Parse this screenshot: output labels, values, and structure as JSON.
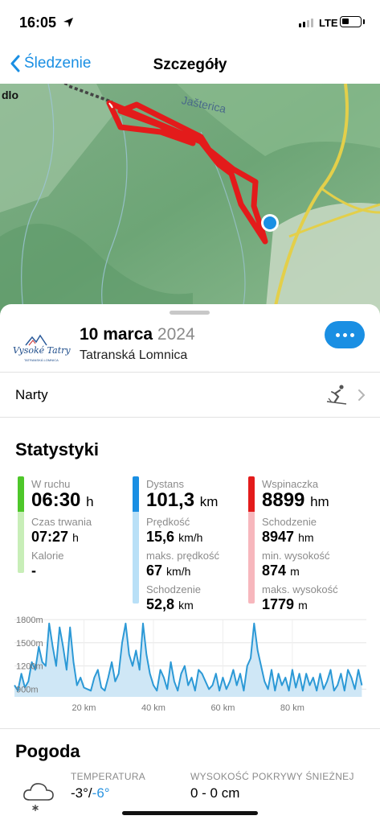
{
  "status": {
    "time": "16:05",
    "network": "LTE"
  },
  "nav": {
    "back_label": "Śledzenie",
    "title": "Szczegóły"
  },
  "map": {
    "labels": [
      "dlo",
      "Jašterica"
    ]
  },
  "activity": {
    "date_day": "10 marca",
    "date_year": "2024",
    "place": "Tatranská Lomnica",
    "logo_text": "Vysoké Tatry",
    "logo_subtext": "TATRANSKÁ LOMNICA"
  },
  "sport": {
    "label": "Narty",
    "icon": "skier-icon"
  },
  "stats": {
    "title": "Statystyki",
    "movement": {
      "label": "W ruchu",
      "value": "06:30",
      "unit": "h",
      "duration_label": "Czas trwania",
      "duration_value": "07:27",
      "duration_unit": "h",
      "calories_label": "Kalorie",
      "calories_value": "-"
    },
    "distance": {
      "label": "Dystans",
      "value": "101,3",
      "unit": "km",
      "speed_label": "Prędkość",
      "speed_value": "15,6",
      "speed_unit": "km/h",
      "max_speed_label": "maks. prędkość",
      "max_speed_value": "67",
      "max_speed_unit": "km/h",
      "descent_label": "Schodzenie",
      "descent_value": "52,8",
      "descent_unit": "km"
    },
    "climb": {
      "label": "Wspinaczka",
      "value": "8899",
      "unit": "hm",
      "descent_label": "Schodzenie",
      "descent_value": "8947",
      "descent_unit": "hm",
      "min_alt_label": "min. wysokość",
      "min_alt_value": "874",
      "min_alt_unit": "m",
      "max_alt_label": "maks. wysokość",
      "max_alt_value": "1779",
      "max_alt_unit": "m"
    },
    "colors": {
      "movement": "#4ec72a",
      "distance": "#1a8fe3",
      "climb": "#e31b1b"
    }
  },
  "chart_data": {
    "type": "area",
    "ylabel_ticks": [
      "1800m",
      "1500m",
      "1200m",
      "900m"
    ],
    "xlabel_ticks": [
      "20 km",
      "40 km",
      "60 km",
      "80 km"
    ],
    "ylim": [
      800,
      1800
    ],
    "xlim": [
      0,
      101.3
    ],
    "x": [
      0,
      1,
      2,
      3,
      4,
      5,
      6,
      7,
      8,
      9,
      10,
      11,
      12,
      13,
      14,
      15,
      16,
      17,
      18,
      19,
      20,
      21,
      22,
      23,
      24,
      25,
      26,
      27,
      28,
      29,
      30,
      31,
      32,
      33,
      34,
      35,
      36,
      37,
      38,
      39,
      40,
      41,
      42,
      43,
      44,
      45,
      46,
      47,
      48,
      49,
      50,
      51,
      52,
      53,
      54,
      55,
      56,
      57,
      58,
      59,
      60,
      61,
      62,
      63,
      64,
      65,
      66,
      67,
      68,
      69,
      70,
      71,
      72,
      73,
      74,
      75,
      76,
      77,
      78,
      79,
      80,
      81,
      82,
      83,
      84,
      85,
      86,
      87,
      88,
      89,
      90,
      91,
      92,
      93,
      94,
      95,
      96,
      97,
      98,
      99,
      100
    ],
    "y": [
      950,
      880,
      1100,
      920,
      1000,
      1250,
      1150,
      1450,
      1250,
      1200,
      1750,
      1450,
      1200,
      1700,
      1450,
      1150,
      1700,
      1250,
      950,
      1050,
      920,
      900,
      880,
      1050,
      1150,
      920,
      880,
      1050,
      1250,
      1000,
      1100,
      1500,
      1750,
      1350,
      1200,
      1400,
      1150,
      1750,
      1350,
      1100,
      950,
      880,
      1150,
      1050,
      900,
      1250,
      1000,
      880,
      1100,
      1200,
      950,
      1050,
      880,
      1150,
      1100,
      1000,
      900,
      950,
      1100,
      880,
      1050,
      900,
      1000,
      1150,
      950,
      1100,
      880,
      1200,
      1300,
      1750,
      1400,
      1200,
      1000,
      900,
      1150,
      880,
      1100,
      950,
      1050,
      880,
      1150,
      920,
      1100,
      880,
      1100,
      950,
      1050,
      880,
      1100,
      900,
      1000,
      1150,
      880,
      950,
      1100,
      880,
      1150,
      1050,
      900,
      1150,
      950
    ]
  },
  "weather": {
    "title": "Pogoda",
    "temp_label": "TEMPERATURA",
    "temp_high": "-3°",
    "temp_sep": "/",
    "temp_low": "-6°",
    "snow_label": "WYSOKOŚĆ POKRYWY ŚNIEŻNEJ",
    "snow_value": "0 - 0 cm",
    "icon": "cloud-snow-icon"
  }
}
